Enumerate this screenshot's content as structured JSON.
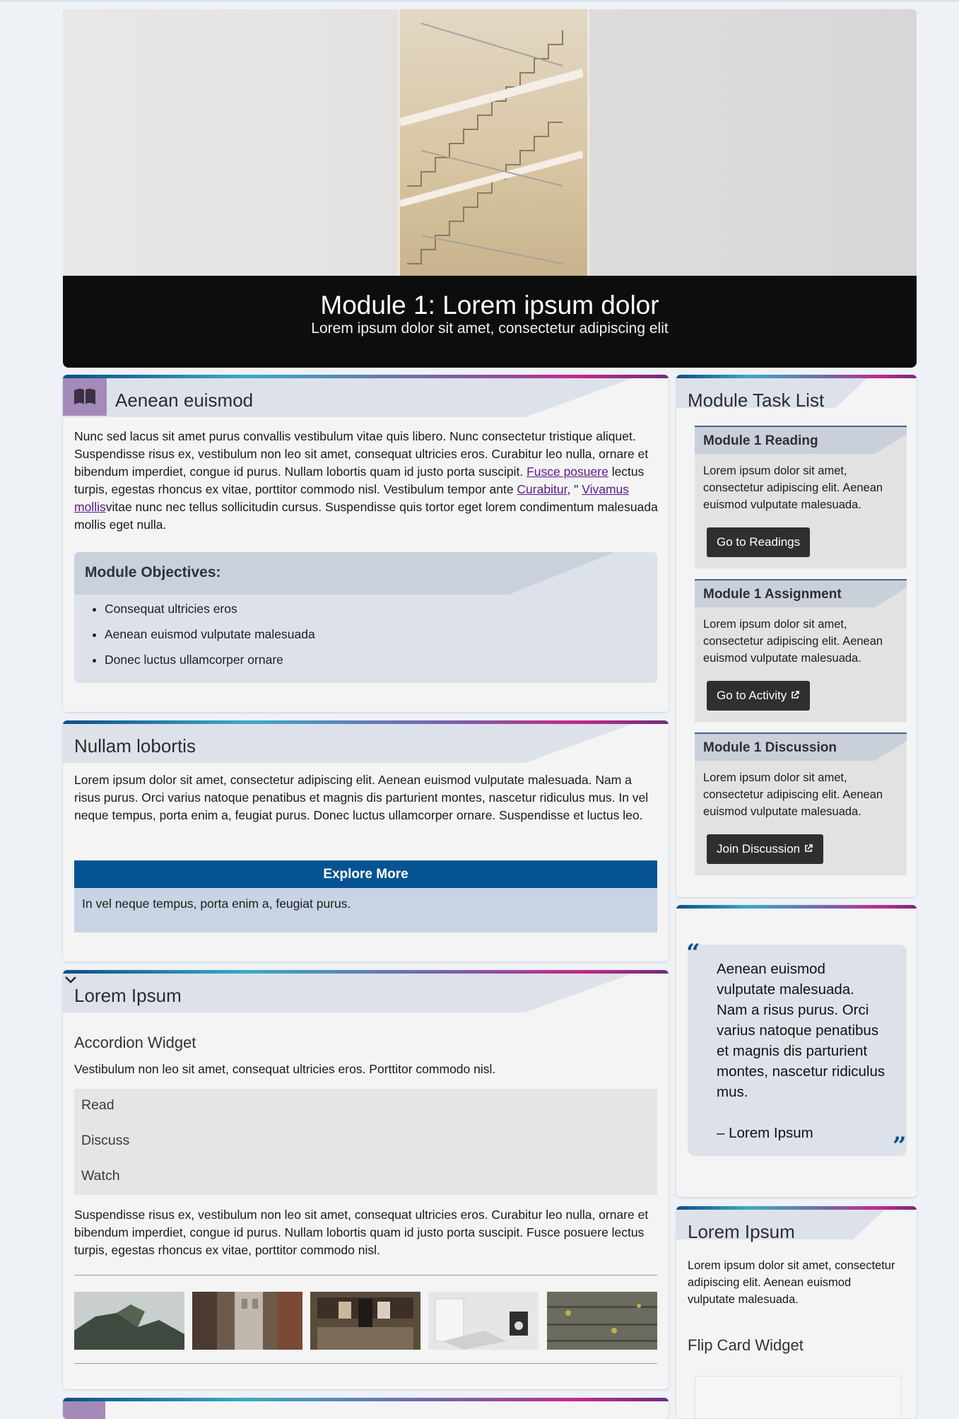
{
  "hero": {
    "title": "Module 1: Lorem ipsum dolor",
    "subtitle": "Lorem ipsum dolor sit amet, consectetur adipiscing elit"
  },
  "card1": {
    "title": "Aenean euismod",
    "p_before": "Nunc sed lacus sit amet purus convallis vestibulum vitae quis libero. Nunc consectetur tristique aliquet. Suspendisse risus ex, vestibulum non leo sit amet, consequat ultricies eros. Curabitur leo nulla, ornare et bibendum imperdiet, congue id purus. Nullam lobortis quam id justo porta suscipit. ",
    "link1": "Fusce posuere",
    "p_mid1": " lectus turpis, egestas rhoncus ex vitae, porttitor commodo nisl. Vestibulum tempor ante ",
    "link2": "Curabitur",
    "p_mid2": ", \" ",
    "link3": "Vivamus mollis",
    "p_after": "vitae nunc nec tellus sollicitudin cursus. Suspendisse quis tortor eget lorem condimentum malesuada mollis eget nulla.",
    "objectives_title": "Module Objectives:",
    "objectives": [
      "Consequat ultricies eros",
      "Aenean euismod vulputate malesuada",
      "Donec luctus ullamcorper ornare"
    ]
  },
  "card2": {
    "title": "Nullam lobortis",
    "text": "Lorem ipsum dolor sit amet, consectetur adipiscing elit. Aenean euismod vulputate malesuada. Nam a risus purus. Orci varius natoque penatibus et magnis dis parturient montes, nascetur ridiculus mus. In vel neque tempus, porta enim a, feugiat purus. Donec luctus ullamcorper ornare. Suspendisse et luctus leo.",
    "explore_label": "Explore More",
    "explore_text": "In vel neque tempus, porta enim a, feugiat purus."
  },
  "card3": {
    "title": "Lorem Ipsum",
    "widget_title": "Accordion Widget",
    "widget_text": "Vestibulum non leo sit amet, consequat ultricies eros. Porttitor commodo nisl.",
    "accordion": [
      "Read",
      "Discuss",
      "Watch"
    ],
    "after_text": "Suspendisse risus ex, vestibulum non leo sit amet, consequat ultricies eros. Curabitur leo nulla, ornare et bibendum imperdiet, congue id purus. Nullam lobortis quam id justo porta suscipit. Fusce posuere lectus turpis, egestas rhoncus ex vitae, porttitor commodo nisl."
  },
  "tasklist": {
    "title": "Module Task List",
    "tasks": [
      {
        "name": "Module 1 Reading",
        "desc": "Lorem ipsum dolor sit amet, consectetur adipiscing elit. Aenean euismod vulputate malesuada.",
        "button": "Go to Readings"
      },
      {
        "name": "Module 1 Assignment",
        "desc": "Lorem ipsum dolor sit amet, consectetur adipiscing elit. Aenean euismod vulputate malesuada.",
        "button": "Go to Activity"
      },
      {
        "name": "Module 1 Discussion",
        "desc": "Lorem ipsum dolor sit amet, consectetur adipiscing elit. Aenean euismod vulputate malesuada.",
        "button": "Join Discussion"
      }
    ]
  },
  "quote": {
    "open_mark": "“",
    "close_mark": "”",
    "text": "Aenean euismod vulputate malesuada. Nam a risus purus. Orci varius natoque penatibus et magnis dis parturient montes, nascetur ridiculus mus.",
    "author": "– Lorem Ipsum"
  },
  "side3": {
    "title": "Lorem Ipsum",
    "text": "Lorem ipsum dolor sit amet, consectetur adipiscing elit. Aenean euismod vulputate malesuada.",
    "widget_title": "Flip Card Widget"
  },
  "colors": {
    "accent_blue": "#065394",
    "card_header": "#dde2ea",
    "button_dark": "#2f2f2f",
    "badge_purple": "#a48ab8"
  }
}
